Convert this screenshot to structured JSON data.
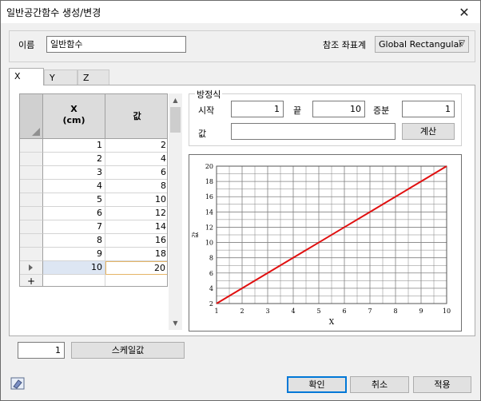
{
  "window": {
    "title": "일반공간함수 생성/변경"
  },
  "name_label": "이름",
  "name_value": "일반함수",
  "ref_label": "참조 좌표계",
  "ref_value": "Global Rectangular",
  "tabs": [
    "X",
    "Y",
    "Z"
  ],
  "table": {
    "col_x_line1": "X",
    "col_x_line2": "(cm)",
    "col_value": "값",
    "rows": [
      {
        "x": "1",
        "v": "2"
      },
      {
        "x": "2",
        "v": "4"
      },
      {
        "x": "3",
        "v": "6"
      },
      {
        "x": "4",
        "v": "8"
      },
      {
        "x": "5",
        "v": "10"
      },
      {
        "x": "6",
        "v": "12"
      },
      {
        "x": "7",
        "v": "14"
      },
      {
        "x": "8",
        "v": "16"
      },
      {
        "x": "9",
        "v": "18"
      },
      {
        "x": "10",
        "v": "20"
      }
    ],
    "new_row_symbol": "+"
  },
  "equation": {
    "title": "방정식",
    "start_label": "시작",
    "start_value": "1",
    "end_label": "끝",
    "end_value": "10",
    "step_label": "증분",
    "step_value": "1",
    "value_label": "값",
    "value_value": "",
    "calc_button": "계산"
  },
  "scale": {
    "value": "1",
    "button": "스케일값"
  },
  "footer": {
    "ok": "확인",
    "cancel": "취소",
    "apply": "적용"
  },
  "colors": {
    "line": "#e01010",
    "grid": "#808080",
    "accent": "#0078d7"
  },
  "icons": {
    "close": "close-icon",
    "eraser": "eraser-icon"
  },
  "chart_data": {
    "type": "line",
    "x": [
      1,
      2,
      3,
      4,
      5,
      6,
      7,
      8,
      9,
      10
    ],
    "series": [
      {
        "values": [
          2,
          4,
          6,
          8,
          10,
          12,
          14,
          16,
          18,
          20
        ]
      }
    ],
    "xlabel": "X",
    "ylabel": "값",
    "xlim": [
      1,
      10
    ],
    "ylim": [
      2,
      20
    ],
    "xticks": [
      1,
      2,
      3,
      4,
      5,
      6,
      7,
      8,
      9,
      10
    ],
    "yticks": [
      2,
      4,
      6,
      8,
      10,
      12,
      14,
      16,
      18,
      20
    ],
    "grid": true
  }
}
